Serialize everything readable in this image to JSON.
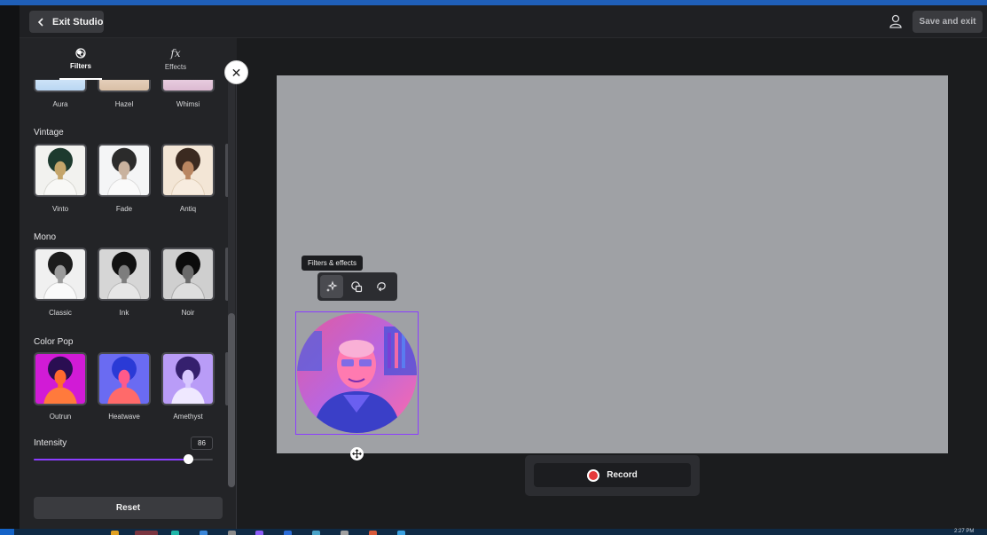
{
  "header": {
    "exit_label": "Exit Studio",
    "save_label": "Save and exit"
  },
  "panel": {
    "tabs": [
      {
        "label": "Filters",
        "icon": "filters-icon",
        "active": true
      },
      {
        "label": "Effects",
        "icon": "fx-icon",
        "active": false
      }
    ],
    "top_row": [
      "Aura",
      "Hazel",
      "Whimsi"
    ],
    "sections": [
      {
        "title": "Vintage",
        "items": [
          "Vinto",
          "Fade",
          "Antiq"
        ]
      },
      {
        "title": "Mono",
        "items": [
          "Classic",
          "Ink",
          "Noir"
        ]
      },
      {
        "title": "Color Pop",
        "items": [
          "Outrun",
          "Heatwave",
          "Amethyst"
        ]
      }
    ],
    "intensity": {
      "label": "Intensity",
      "value": "86",
      "fraction": 0.86
    },
    "reset_label": "Reset"
  },
  "stage": {
    "tooltip": "Filters & effects",
    "record_label": "Record"
  },
  "taskbar": {
    "clock": "2:27 PM"
  },
  "colors": {
    "accent": "#8b3dff",
    "record": "#e5393b",
    "canvas": "#9fa1a5"
  }
}
